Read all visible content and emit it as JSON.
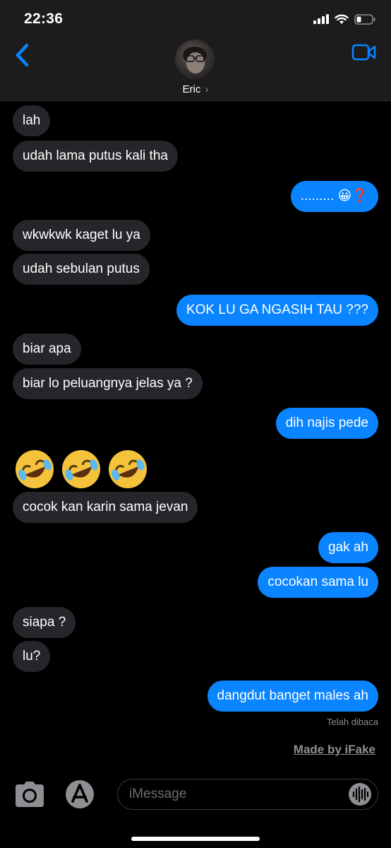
{
  "status_bar": {
    "time": "22:36"
  },
  "header": {
    "contact_name": "Eric",
    "chevron": "›"
  },
  "messages": [
    {
      "text": "lah"
    },
    {
      "text": "udah lama putus kali tha"
    },
    {
      "text": "......... 😀❓"
    },
    {
      "text": "wkwkwk kaget lu ya"
    },
    {
      "text": "udah sebulan putus"
    },
    {
      "text": "KOK LU GA NGASIH TAU ???"
    },
    {
      "text": "biar apa"
    },
    {
      "text": "biar lo peluangnya jelas ya ?"
    },
    {
      "text": "dih najis pede"
    },
    {
      "text": "🤣🤣🤣"
    },
    {
      "text": "cocok kan karin sama jevan"
    },
    {
      "text": "gak ah"
    },
    {
      "text": "cocokan sama lu"
    },
    {
      "text": "siapa ?"
    },
    {
      "text": "lu?"
    },
    {
      "text": "dangdut banget males ah"
    }
  ],
  "read_receipt": "Telah dibaca",
  "watermark": "Made by iFake",
  "composer": {
    "placeholder": "iMessage"
  },
  "colors": {
    "outgoing": "#0a84ff",
    "incoming": "#26252a",
    "accent": "#0a84ff",
    "background": "#000000"
  },
  "icons": [
    "back-chevron-icon",
    "video-camera-icon",
    "camera-icon",
    "app-store-icon",
    "audio-waveform-icon",
    "signal-icon",
    "wifi-icon",
    "battery-icon"
  ]
}
